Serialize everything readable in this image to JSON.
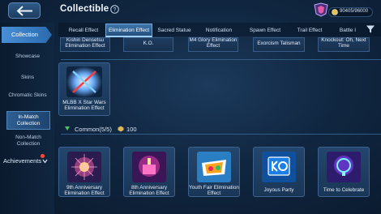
{
  "header": {
    "title": "Collectible",
    "currency_text": "90405/96000",
    "back_icon": "back-arrow-icon",
    "help_icon": "question-mark-icon"
  },
  "tabs": [
    {
      "label": "Recall Effect",
      "active": false
    },
    {
      "label": "Elimination Effect",
      "active": true
    },
    {
      "label": "Sacred Statue",
      "active": false
    },
    {
      "label": "Notification",
      "active": false
    },
    {
      "label": "Spawn Effect",
      "active": false
    },
    {
      "label": "Trail Effect",
      "active": false
    },
    {
      "label": "Battle I",
      "active": false
    }
  ],
  "sidebar": {
    "main_label": "Collection",
    "items": [
      {
        "label": "Showcase",
        "active": false
      },
      {
        "label": "Skins",
        "active": false
      },
      {
        "label": "Chromatic Skins",
        "active": false
      },
      {
        "label": "In-Match Collection",
        "active": true
      },
      {
        "label": "Non-Match Collection",
        "active": false
      }
    ],
    "achievements_label": "Achievements"
  },
  "top_row_partial": [
    {
      "label": "Kishin Densetsu Elimination Effect"
    },
    {
      "label": "K.O."
    },
    {
      "label": "M4 Glory Elimination Effect"
    },
    {
      "label": "Exorcism Talisman"
    },
    {
      "label": "Knockout: Oh, Next Time"
    }
  ],
  "featured_card": {
    "label": "MLBB X Star Wars Elimination Effect"
  },
  "common_section": {
    "title": "Common(5/5)",
    "points": "100"
  },
  "common_cards": [
    {
      "label": "9th Anniversary Elimination Effect"
    },
    {
      "label": "8th Anniversary Elimination Effect"
    },
    {
      "label": "Youth Fair Elimination Effect"
    },
    {
      "label": "Joyous Party"
    },
    {
      "label": "Time to Celebrate"
    }
  ],
  "colors": {
    "accent": "#4a8fd6",
    "active_tab": "#3d76ad",
    "background": "#102640",
    "notification_dot": "#ff4a3a"
  }
}
